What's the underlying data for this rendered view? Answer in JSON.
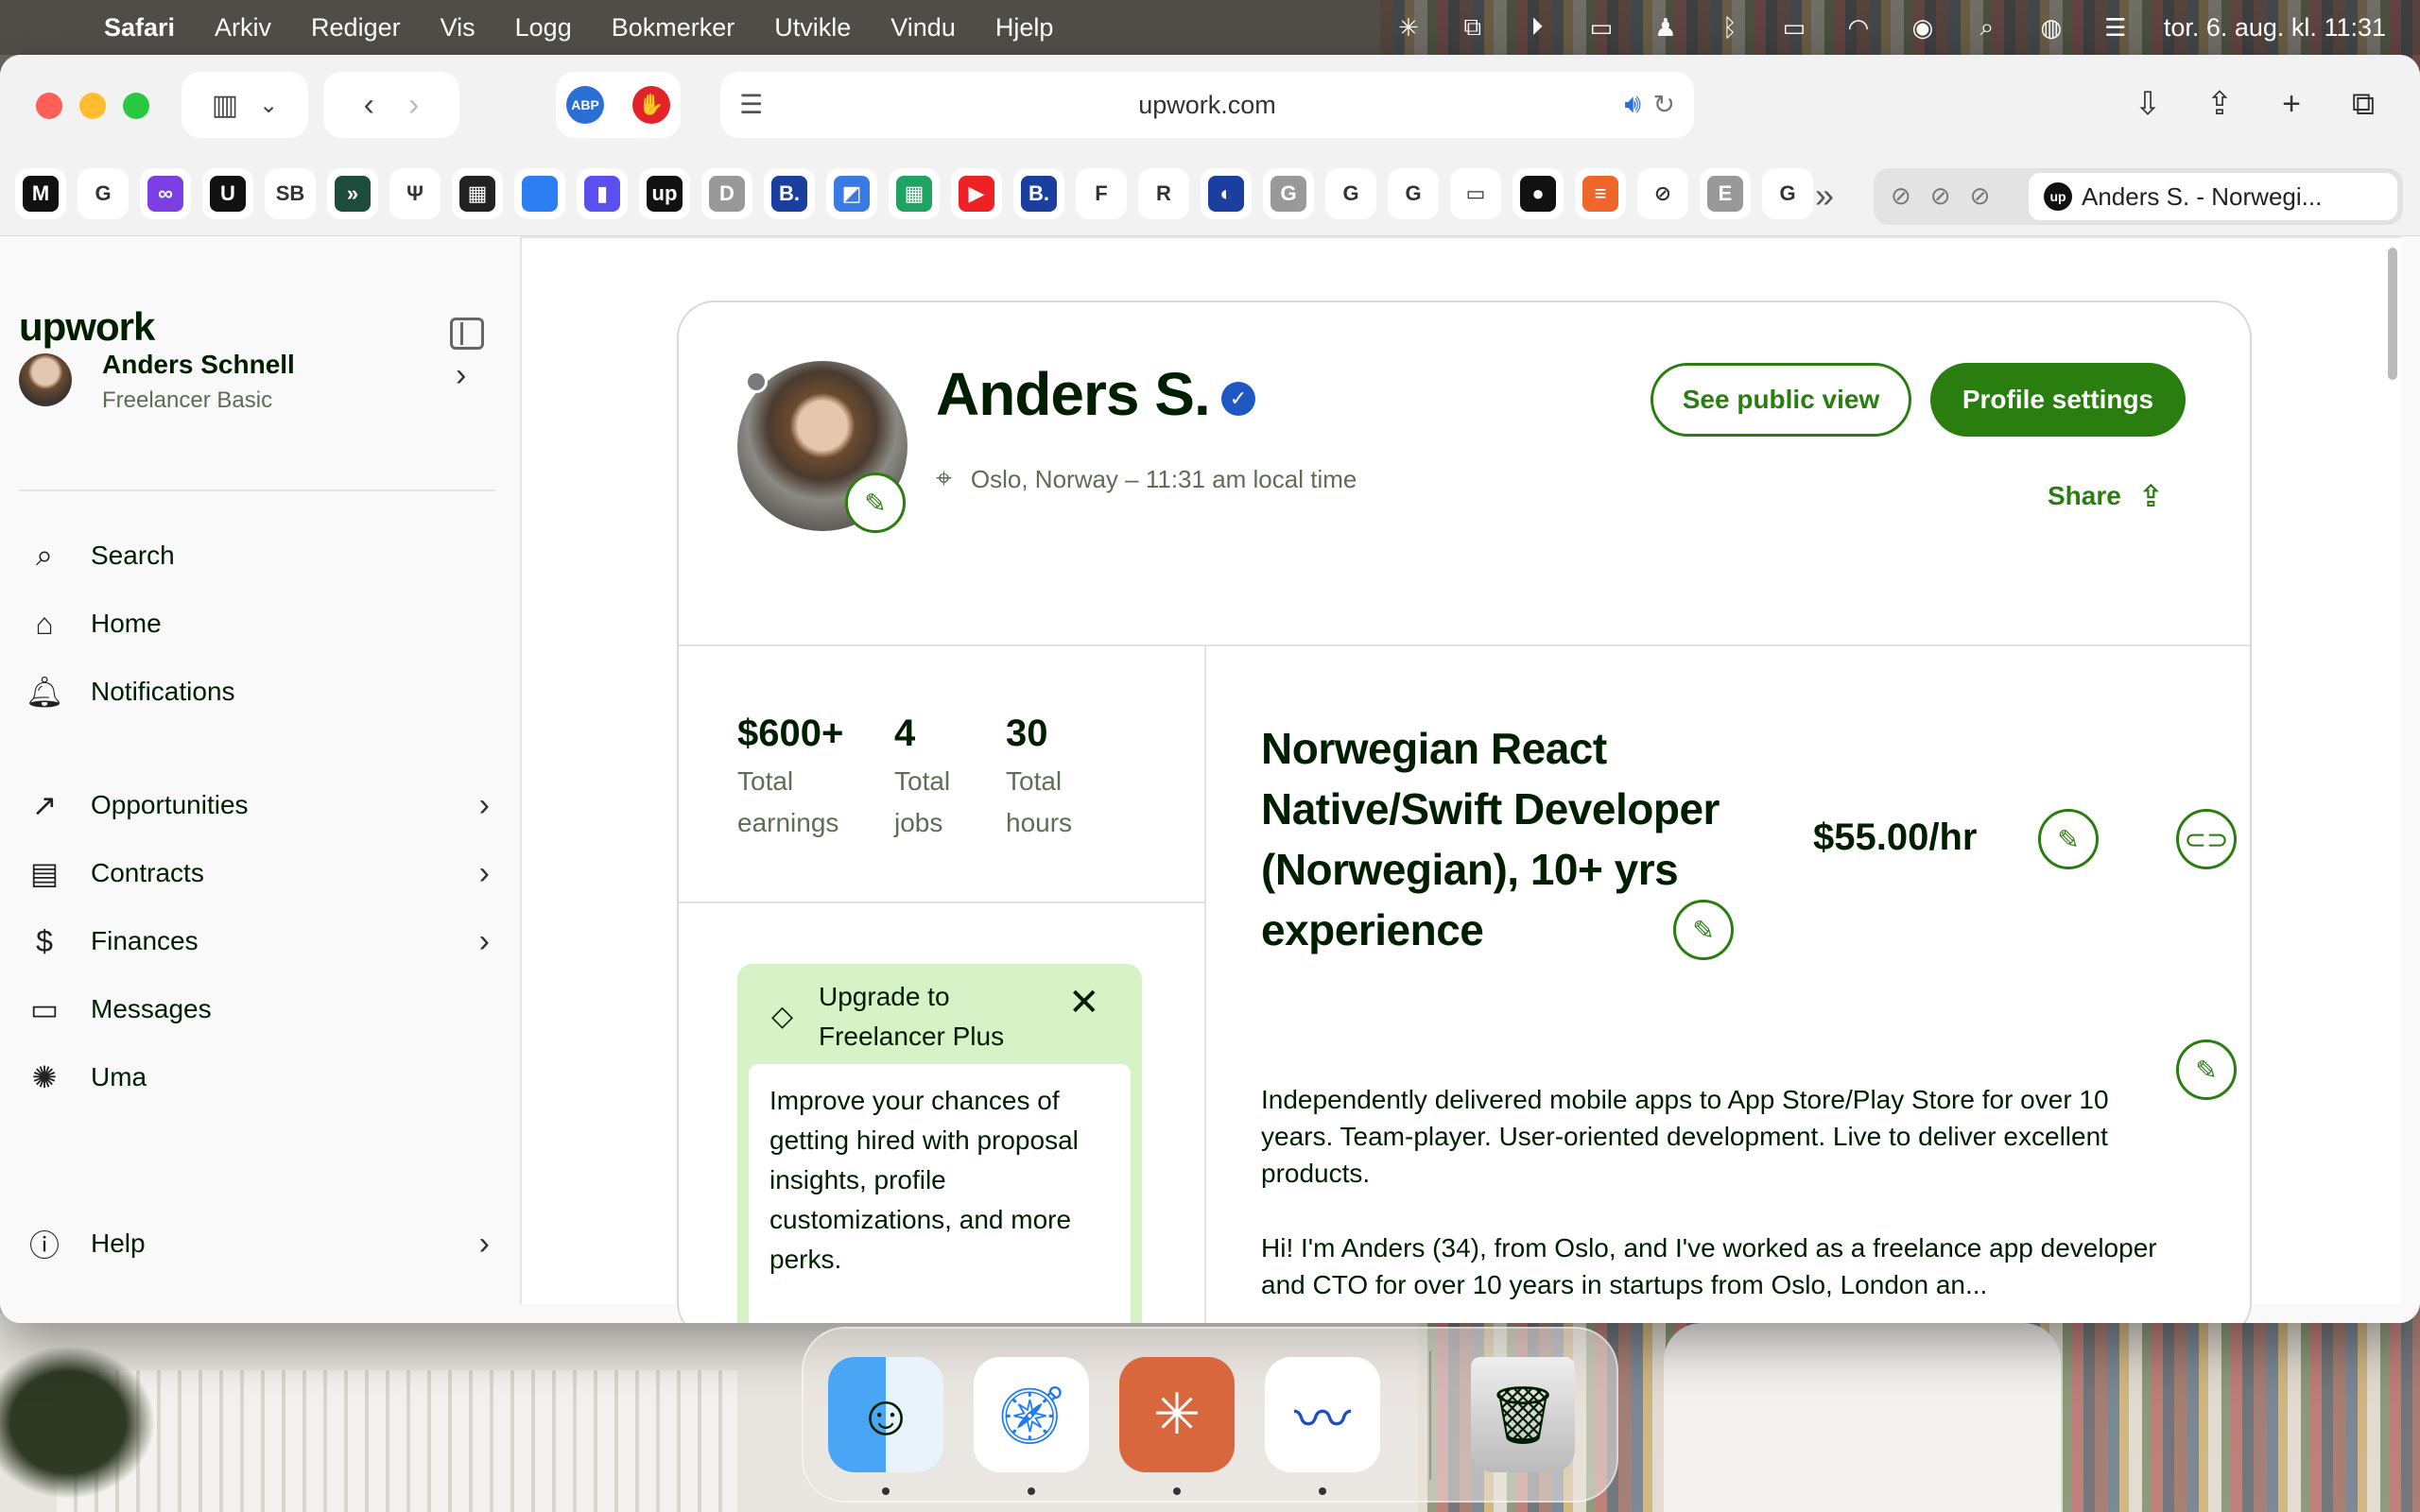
{
  "menubar": {
    "app": "Safari",
    "items": [
      "Arkiv",
      "Rediger",
      "Vis",
      "Logg",
      "Bokmerker",
      "Utvikle",
      "Vindu",
      "Hjelp"
    ],
    "clock": "tor. 6. aug. kl. 11:31"
  },
  "browser": {
    "url": "upwork.com",
    "tab_title": "Anders S. - Norwegi...",
    "favorites": [
      {
        "icon": "medium",
        "label": "M"
      },
      {
        "icon": "google",
        "label": "G"
      },
      {
        "icon": "purple",
        "label": "∞"
      },
      {
        "icon": "u",
        "label": "U"
      },
      {
        "icon": "sb",
        "label": "SB"
      },
      {
        "icon": "green-v",
        "label": "»"
      },
      {
        "icon": "trident",
        "label": "Ψ"
      },
      {
        "icon": "calendar",
        "label": "▦"
      },
      {
        "icon": "apple",
        "label": ""
      },
      {
        "icon": "bookmark",
        "label": "▮"
      },
      {
        "icon": "upwork",
        "label": "up"
      },
      {
        "icon": "d",
        "label": "D"
      },
      {
        "icon": "booking",
        "label": "B."
      },
      {
        "icon": "shortcut",
        "label": "◩"
      },
      {
        "icon": "sheets",
        "label": "▦"
      },
      {
        "icon": "youtube",
        "label": "▶"
      },
      {
        "icon": "booking2",
        "label": "B."
      },
      {
        "icon": "f",
        "label": "F"
      },
      {
        "icon": "r",
        "label": "R"
      },
      {
        "icon": "c",
        "label": "◐"
      },
      {
        "icon": "g-grey",
        "label": "G"
      },
      {
        "icon": "google2",
        "label": "G"
      },
      {
        "icon": "google3",
        "label": "G"
      },
      {
        "icon": "box",
        "label": "▭"
      },
      {
        "icon": "github",
        "label": "●"
      },
      {
        "icon": "stack",
        "label": "≡"
      },
      {
        "icon": "compass",
        "label": "⊘"
      },
      {
        "icon": "e",
        "label": "E"
      },
      {
        "icon": "google4",
        "label": "G"
      }
    ]
  },
  "sidebar": {
    "logo": "upwork",
    "user_name": "Anders Schnell",
    "user_plan": "Freelancer Basic",
    "nav_top": [
      {
        "label": "Search",
        "icon": "search-icon"
      },
      {
        "label": "Home",
        "icon": "home-icon"
      },
      {
        "label": "Notifications",
        "icon": "bell-icon"
      }
    ],
    "nav_main": [
      {
        "label": "Opportunities",
        "icon": "trend-icon"
      },
      {
        "label": "Contracts",
        "icon": "briefcase-icon"
      },
      {
        "label": "Finances",
        "icon": "dollar-icon"
      },
      {
        "label": "Messages",
        "icon": "message-icon"
      },
      {
        "label": "Uma",
        "icon": "uma-icon"
      }
    ],
    "help": "Help"
  },
  "profile": {
    "name": "Anders S.",
    "location": "Oslo, Norway – 11:31 am local time",
    "see_public": "See public view",
    "settings": "Profile settings",
    "share": "Share",
    "stats": [
      {
        "value": "$600+",
        "label1": "Total",
        "label2": "earnings"
      },
      {
        "value": "4",
        "label1": "Total",
        "label2": "jobs"
      },
      {
        "value": "30",
        "label1": "Total",
        "label2": "hours"
      }
    ],
    "upgrade_title": "Upgrade to Freelancer Plus",
    "upgrade_body": "Improve your chances of getting hired with proposal insights, profile customizations, and more perks.",
    "headline": "Norwegian React Native/Swift Developer (Norwegian), 10+ yrs experience",
    "rate": "$55.00/hr",
    "desc1": "Independently delivered mobile apps to App Store/Play Store for over 10 years. Team-player. User-oriented development. Live to deliver excellent products.",
    "desc2": "Hi! I'm Anders (34), from Oslo, and I've worked as a freelance app developer and CTO for over 10 years in startups from Oslo, London an..."
  },
  "colors": {
    "brand_green": "#2a7e0f",
    "text": "#001e00",
    "muted": "#5e6d55"
  }
}
